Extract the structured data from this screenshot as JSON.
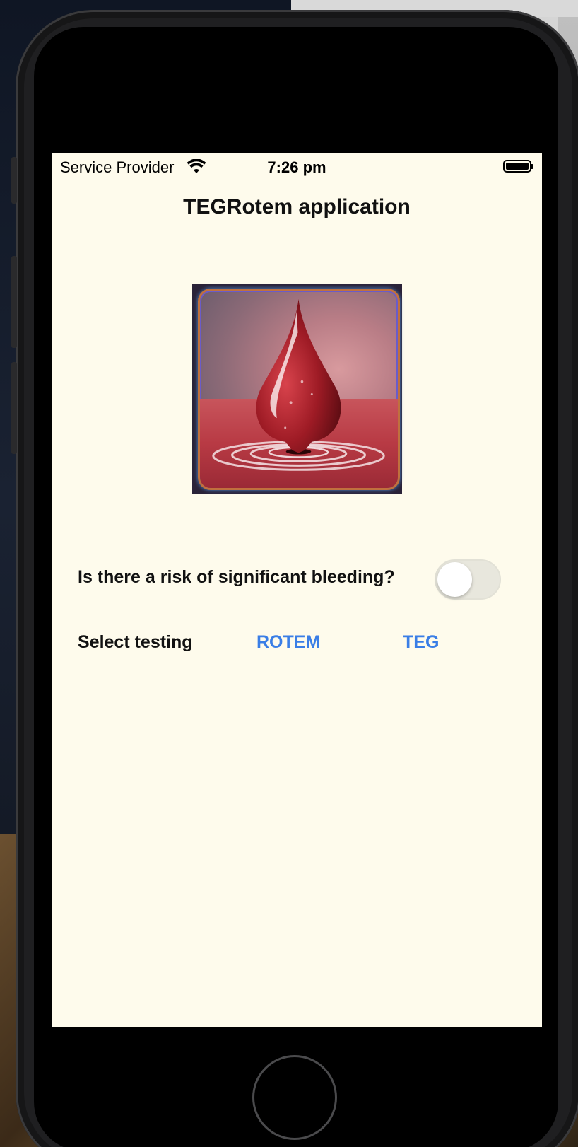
{
  "status_bar": {
    "carrier": "Service Provider",
    "time": "7:26 pm",
    "wifi_icon": "wifi-icon",
    "battery_icon": "battery-full-icon"
  },
  "app": {
    "title": "TEGRotem application",
    "image": "blood-drop-image"
  },
  "risk": {
    "question": "Is there a risk of significant bleeding?",
    "toggle_on": false
  },
  "testing": {
    "label": "Select testing",
    "options": [
      "ROTEM",
      "TEG"
    ]
  },
  "colors": {
    "background": "#fefbec",
    "accent": "#3a7ee6",
    "toggle_off": "#e8e7dd"
  }
}
